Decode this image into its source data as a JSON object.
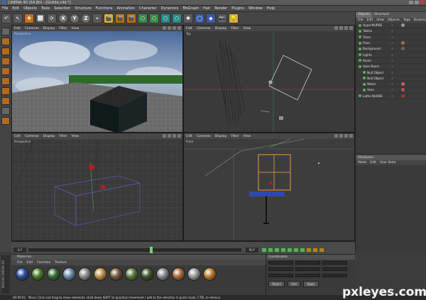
{
  "window": {
    "title": "CINEMA 4D (64 Bit) - [Grillite.c4d *]"
  },
  "menubar": {
    "items": [
      "File",
      "Edit",
      "Objects",
      "Tools",
      "Selection",
      "Structure",
      "Functions",
      "Animation",
      "Character",
      "Dynamics",
      "MoGraph",
      "Hair",
      "Render",
      "Plugins",
      "Window",
      "Help"
    ]
  },
  "toolbar": {
    "tools": [
      "↶",
      "↖",
      "✥",
      "⬜",
      "⟳",
      "X",
      "Y",
      "Z",
      "⌖",
      "🎬",
      "🎬",
      "🎬",
      "⬡",
      "⬡",
      "⬡",
      "⬡",
      "✱",
      "◯",
      "◆",
      "📷",
      "💡"
    ]
  },
  "viewports": [
    {
      "label": "Perspective",
      "menu": [
        "Edit",
        "Cameras",
        "Display",
        "Filter",
        "View"
      ]
    },
    {
      "label": "Top",
      "menu": [
        "Edit",
        "Cameras",
        "Display",
        "Filter",
        "View"
      ]
    },
    {
      "label": "Perspective",
      "menu": [
        "Edit",
        "Cameras",
        "Display",
        "Filter",
        "View"
      ]
    },
    {
      "label": "Front",
      "menu": [
        "Edit",
        "Cameras",
        "Display",
        "Filter",
        "View"
      ]
    }
  ],
  "objects_panel": {
    "tabs": [
      "Objects",
      "Structure"
    ],
    "menu": [
      "File",
      "Edit",
      "View",
      "Objects",
      "Tags",
      "Bookmarks"
    ],
    "items": [
      {
        "name": "HyperNURBS",
        "tag_color": "#999"
      },
      {
        "name": "Tables",
        "tag_color": ""
      },
      {
        "name": "Trees",
        "tag_color": ""
      },
      {
        "name": "Floor",
        "tag_color": "#a07040"
      },
      {
        "name": "Background",
        "tag_color": "#666"
      },
      {
        "name": "Lights",
        "tag_color": ""
      },
      {
        "name": "Room",
        "tag_color": ""
      },
      {
        "name": "Vase-Room",
        "tag_color": ""
      },
      {
        "name": "Null Object",
        "tag_color": ""
      },
      {
        "name": "Null Object",
        "tag_color": ""
      },
      {
        "name": "Water",
        "tag_color": "#c06060"
      },
      {
        "name": "Vase",
        "tag_color": "#c05050"
      },
      {
        "name": "Lathe NURBS",
        "tag_color": "#b03030"
      }
    ]
  },
  "attributes_panel": {
    "title": "Attributes",
    "menu": [
      "Mode",
      "Edit",
      "User Data"
    ]
  },
  "timeline": {
    "start": "0 F",
    "end": "90 F",
    "current_fraction": 0.57
  },
  "materials_panel": {
    "title": "Materials",
    "menu": [
      "File",
      "Edit",
      "Function",
      "Texture"
    ],
    "swatches": [
      "#2a4fa0",
      "#4a7a2a",
      "#3a6a3a",
      "#6a8aa8",
      "#8a8a8a",
      "#c09048",
      "#7a5a3a",
      "#5a7a3a",
      "#3a5a2a",
      "#8a8a8a",
      "#aa6a3a",
      "#9a9a9a",
      "#c07a2a"
    ]
  },
  "coordinates_panel": {
    "title": "Coordinates",
    "buttons": [
      "Object",
      "Size",
      "Apply"
    ]
  },
  "status": {
    "time": "00:00:03",
    "message": "Move: Click and drag to move elements. Hold down SHIFT to quantize movement / add to the selection in point mode, CTRL to remove."
  },
  "brand": {
    "side": "MAXON CINEMA 4D",
    "watermark": "pxleyes.com"
  }
}
